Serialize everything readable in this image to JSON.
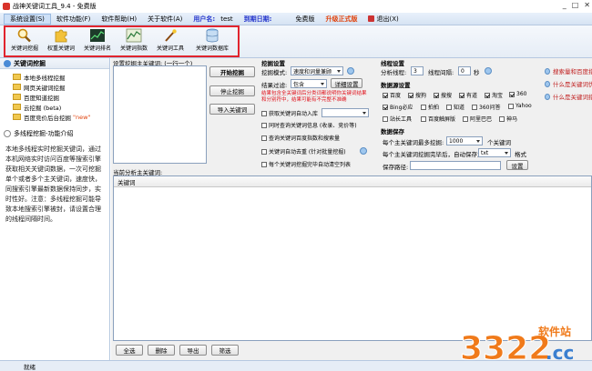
{
  "window": {
    "title": "战神关键词工具_9.4 - 免费版"
  },
  "menu": {
    "items": [
      "系统设置(S)",
      "软件功能(F)",
      "软件帮助(H)",
      "关于软件(A)"
    ],
    "user_label": "用户名:",
    "user_value": "test",
    "expiry_label": "到期日期:",
    "edition": "免费版",
    "upgrade": "升级正式版",
    "exit": "退出(X)"
  },
  "toolbar": {
    "buttons": [
      {
        "label": "关键词挖掘",
        "icon": "search-icon"
      },
      {
        "label": "权重关键词",
        "icon": "puzzle-icon"
      },
      {
        "label": "关键词排名",
        "icon": "rank-chart-icon"
      },
      {
        "label": "关键词指数",
        "icon": "index-chart-icon"
      },
      {
        "label": "关键词工具",
        "icon": "magic-wand-icon"
      },
      {
        "label": "关键词数据库",
        "icon": "database-icon"
      }
    ]
  },
  "sidebar": {
    "section1": "关键词挖掘",
    "tree": [
      {
        "label": "本地多线程挖掘"
      },
      {
        "label": "网页关键词挖掘"
      },
      {
        "label": "百度知道挖掘"
      },
      {
        "label": "云挖掘 (beta)"
      },
      {
        "label": "百度竞价后台挖掘",
        "badge": "\"new\""
      }
    ],
    "section2": "多线程挖掘-功能介绍",
    "help": "本地多线程实时挖掘关键词，通过本机网络实时访问百度等搜索引擎获取相关关键词数据，一次可挖掘单个或者多个主关键词，速度快，同搜索引擎最新数据保持同步，实时性好。注意：多线程挖掘可能导致本地搜索引擎被封，请设置合理的线程间隔时间。"
  },
  "main": {
    "seed_label": "设置挖掘主关键词: (一行一个)",
    "start_button": "开始挖掘",
    "stop_button": "停止挖掘",
    "import_button": "导入关键词",
    "settings_title": "挖掘设置",
    "mode_label": "挖掘模式:",
    "mode_value": "速度和词量兼顾",
    "filter_label": "结果过滤:",
    "filter_value": "包含",
    "filter_detail_button": "详细设置",
    "filter_note": "结果包含全关键词后分类词都说明你关键词结果和分别符中，结果可能有不完整不准确",
    "options": [
      {
        "label": "获取关键词自动入库",
        "checked": false
      },
      {
        "label": "同时查询关键词信息 (收录、竞价等)",
        "checked": false
      },
      {
        "label": "查询关键词百度指数和搜索量",
        "checked": false
      },
      {
        "label": "关键词自动去重 (针对批量挖掘)",
        "checked": false
      },
      {
        "label": "每个关键词挖掘完毕自动清空列表",
        "checked": false
      }
    ],
    "thread_title": "线程设置",
    "thread_count_label": "分析线程:",
    "thread_count_value": "3",
    "interval_label": "线程间隔:",
    "interval_value": "0",
    "interval_unit": "秒",
    "source_title": "数据源设置",
    "sources": [
      {
        "label": "百度",
        "checked": true
      },
      {
        "label": "搜狗",
        "checked": true
      },
      {
        "label": "搜搜",
        "checked": true
      },
      {
        "label": "有道",
        "checked": true
      },
      {
        "label": "淘宝",
        "checked": true
      },
      {
        "label": "360",
        "checked": true
      },
      {
        "label": "Bing必应",
        "checked": true
      },
      {
        "label": "拍拍",
        "checked": false
      },
      {
        "label": "知道",
        "checked": false
      },
      {
        "label": "360问答",
        "checked": false
      },
      {
        "label": "Yahoo",
        "checked": false
      },
      {
        "label": "站长工具",
        "checked": false
      },
      {
        "label": "百度触屏版",
        "checked": false
      },
      {
        "label": "阿里巴巴",
        "checked": false
      },
      {
        "label": "神马",
        "checked": false
      }
    ],
    "save_title": "数据保存",
    "max_save_label": "每个主关键词最多挖掘:",
    "max_save_value": "1000",
    "max_save_unit": "个关键词",
    "auto_save_label": "每个主关键词挖掘完毕后，自动保存为:",
    "auto_save_format": "txt",
    "auto_save_unit": "格式",
    "save_path_label": "保存路径:",
    "save_path_button": "设置",
    "analysis_label": "当前分析主关键词:",
    "grid_header": "关键词",
    "bottom_buttons": [
      "全选",
      "删除",
      "导出",
      "筛选"
    ]
  },
  "links": [
    "搜索量和百度指数",
    "什么是关键词优化",
    "什么是关键词指数"
  ],
  "status": {
    "text": "就绪"
  },
  "watermark": {
    "text1": "3322",
    "text2": "软件站",
    "text3": ".cc"
  }
}
